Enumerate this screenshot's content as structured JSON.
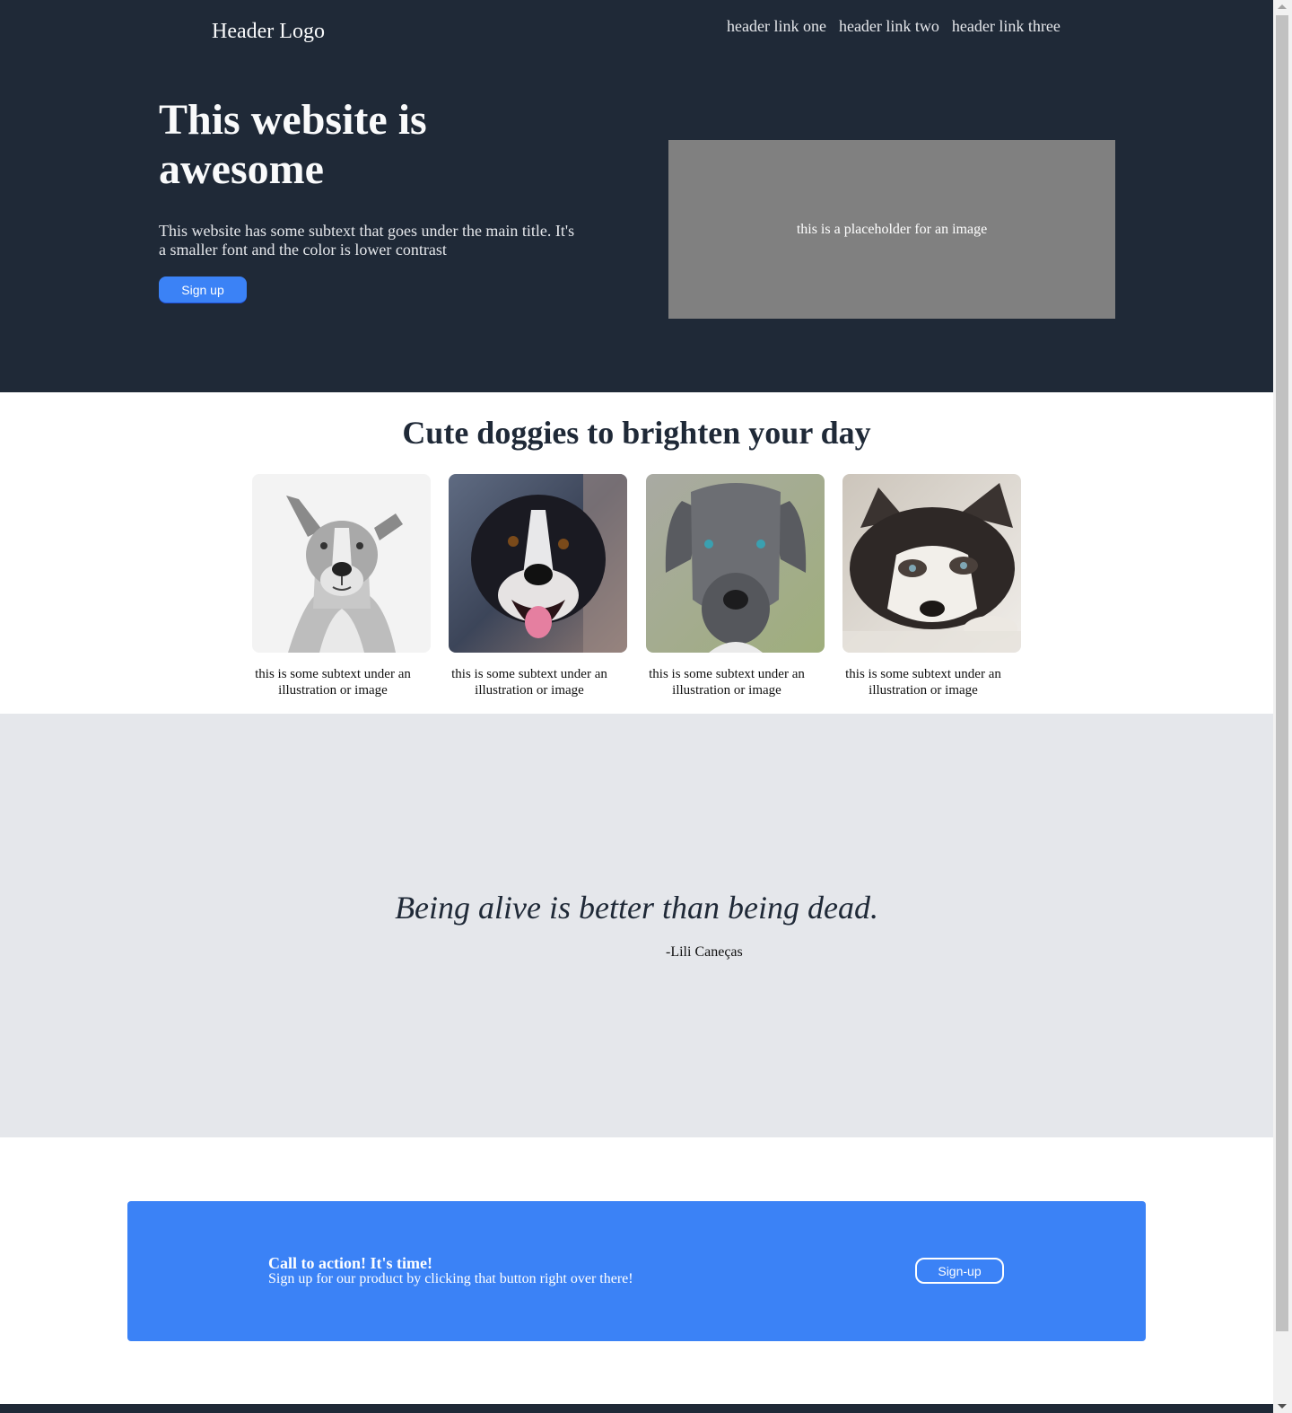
{
  "header": {
    "logo": "Header Logo",
    "links": [
      "header link one",
      "header link two",
      "header link three"
    ]
  },
  "hero": {
    "title": "This website is awesome",
    "subtext": "This website has some subtext that goes under the main title. It's a smaller font and the color is lower contrast",
    "button_label": "Sign up",
    "image_placeholder": "this is a placeholder for an image"
  },
  "dogs": {
    "title": "Cute doggies to brighten your day",
    "cards": [
      {
        "caption": "this is some subtext under an illustration or image",
        "icon": "dog-photo-gray-pitbull"
      },
      {
        "caption": "this is some subtext under an illustration or image",
        "icon": "dog-photo-border-collie"
      },
      {
        "caption": "this is some subtext under an illustration or image",
        "icon": "dog-photo-great-dane"
      },
      {
        "caption": "this is some subtext under an illustration or image",
        "icon": "dog-photo-husky-puppy"
      }
    ]
  },
  "quote": {
    "text": "Being alive is better than being dead.",
    "author": "-Lili Caneças"
  },
  "cta": {
    "title": "Call to action! It's time!",
    "subtext": "Sign up for our product by clicking that button right over there!",
    "button_label": "Sign-up"
  },
  "colors": {
    "dark": "#1f2937",
    "accent": "#3b82f6",
    "light_gray": "#e5e7eb",
    "placeholder": "#808080"
  }
}
